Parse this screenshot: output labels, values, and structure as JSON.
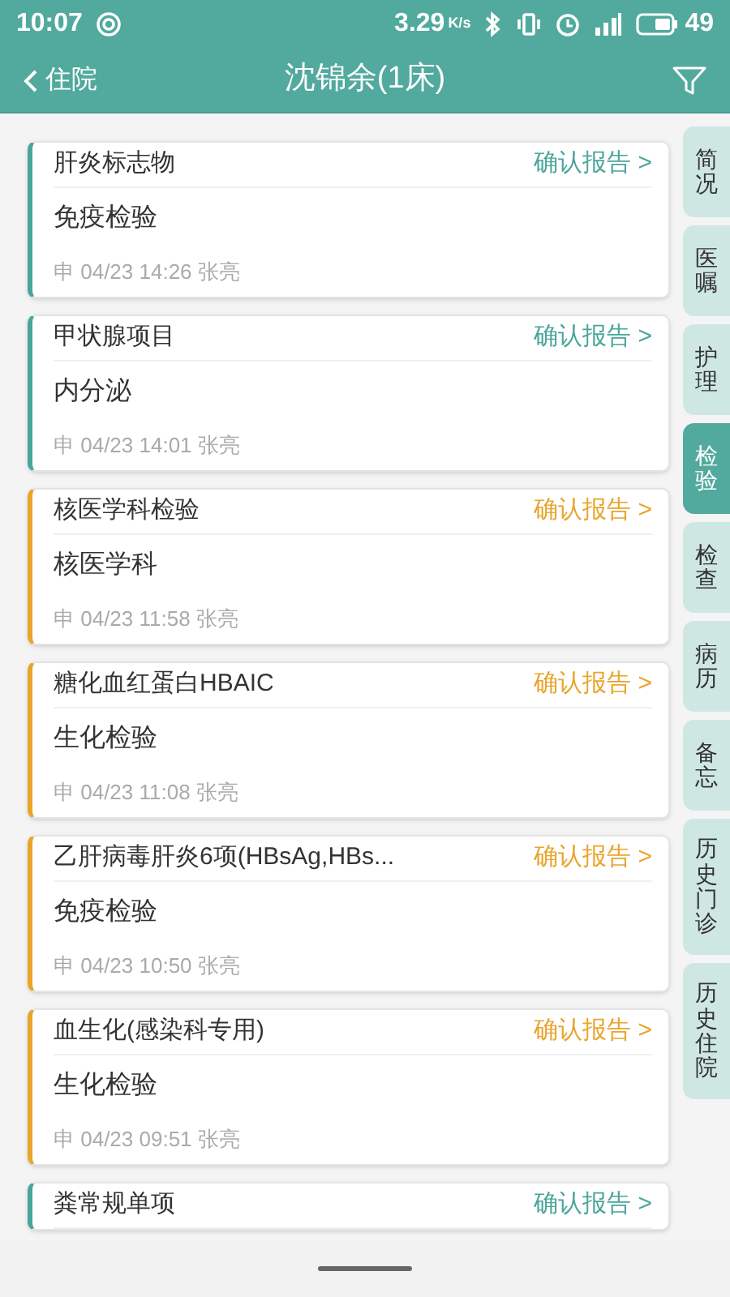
{
  "status_bar": {
    "time": "10:07",
    "speed": "3.29",
    "speed_unit": "K/s",
    "battery": "49"
  },
  "header": {
    "back_label": "住院",
    "title": "沈锦余(1床)"
  },
  "reports": [
    {
      "title": "肝炎标志物",
      "action": "确认报告 >",
      "category": "免疫检验",
      "meta": "申 04/23 14:26 张亮",
      "color": "#4aa59a"
    },
    {
      "title": "甲状腺项目",
      "action": "确认报告 >",
      "category": "内分泌",
      "meta": "申 04/23 14:01 张亮",
      "color": "#4aa59a"
    },
    {
      "title": "核医学科检验",
      "action": "确认报告 >",
      "category": "核医学科",
      "meta": "申 04/23 11:58 张亮",
      "color": "#e9a42c"
    },
    {
      "title": "糖化血红蛋白HBAIC",
      "action": "确认报告 >",
      "category": "生化检验",
      "meta": "申 04/23 11:08 张亮",
      "color": "#e9a42c"
    },
    {
      "title": "乙肝病毒肝炎6项(HBsAg,HBs...",
      "action": "确认报告 >",
      "category": "免疫检验",
      "meta": "申 04/23 10:50 张亮",
      "color": "#e9a42c"
    },
    {
      "title": "血生化(感染科专用)",
      "action": "确认报告 >",
      "category": "生化检验",
      "meta": "申 04/23 09:51 张亮",
      "color": "#e9a42c"
    },
    {
      "title": "粪常规单项",
      "action": "确认报告 >",
      "color": "#4aa59a"
    }
  ],
  "side_tabs": [
    {
      "label": "简况",
      "selected": false
    },
    {
      "label": "医嘱",
      "selected": false
    },
    {
      "label": "护理",
      "selected": false
    },
    {
      "label": "检验",
      "selected": true
    },
    {
      "label": "检查",
      "selected": false
    },
    {
      "label": "病历",
      "selected": false
    },
    {
      "label": "备忘",
      "selected": false
    },
    {
      "label": "历史门诊",
      "selected": false
    },
    {
      "label": "历史住院",
      "selected": false
    }
  ]
}
